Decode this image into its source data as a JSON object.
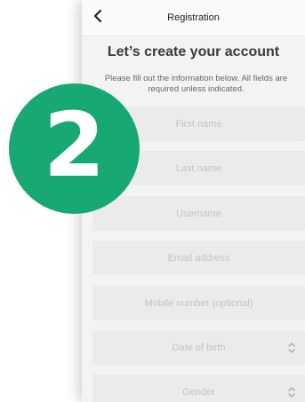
{
  "header": {
    "title": "Registration"
  },
  "main": {
    "heading": "Let’s create your account",
    "subtitle": "Please fill out the information below. All fields are required unless indicated."
  },
  "form": {
    "first_name_placeholder": "First name",
    "last_name_placeholder": "Last name",
    "username_placeholder": "Username",
    "email_placeholder": "Email address",
    "mobile_placeholder": "Mobile number (optional)",
    "dob_placeholder": "Date of birth",
    "gender_placeholder": "Gender"
  },
  "badge": {
    "number": "2",
    "color": "#18a874"
  },
  "icons": {
    "back": "chevron-left-icon",
    "select": "chevron-up-down-icon"
  }
}
